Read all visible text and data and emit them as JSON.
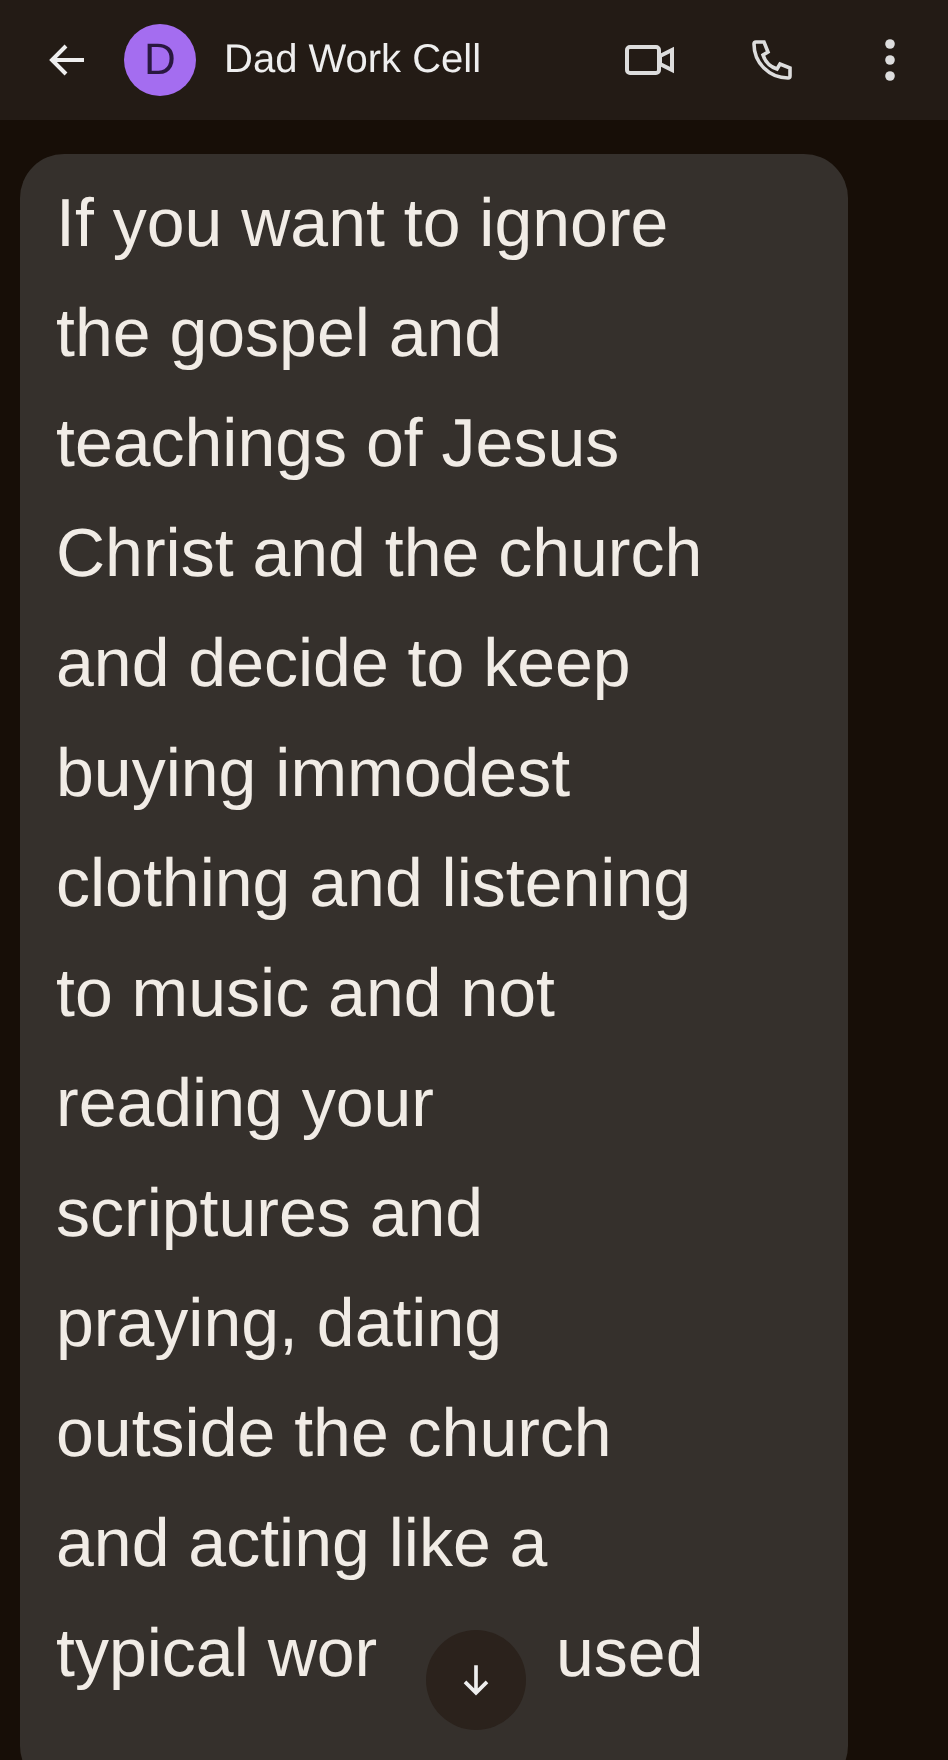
{
  "header": {
    "avatar_letter": "D",
    "contact_name": "Dad Work Cell"
  },
  "message": {
    "text": "If you want to ignore\nthe gospel and\nteachings of Jesus\nChrist and the church\nand decide to keep\nbuying immodest\nclothing and listening\nto music and not\nreading your\nscriptures and\npraying, dating\noutside the church\nand acting like a",
    "last_line_parts": [
      "typical wor",
      "used"
    ]
  }
}
